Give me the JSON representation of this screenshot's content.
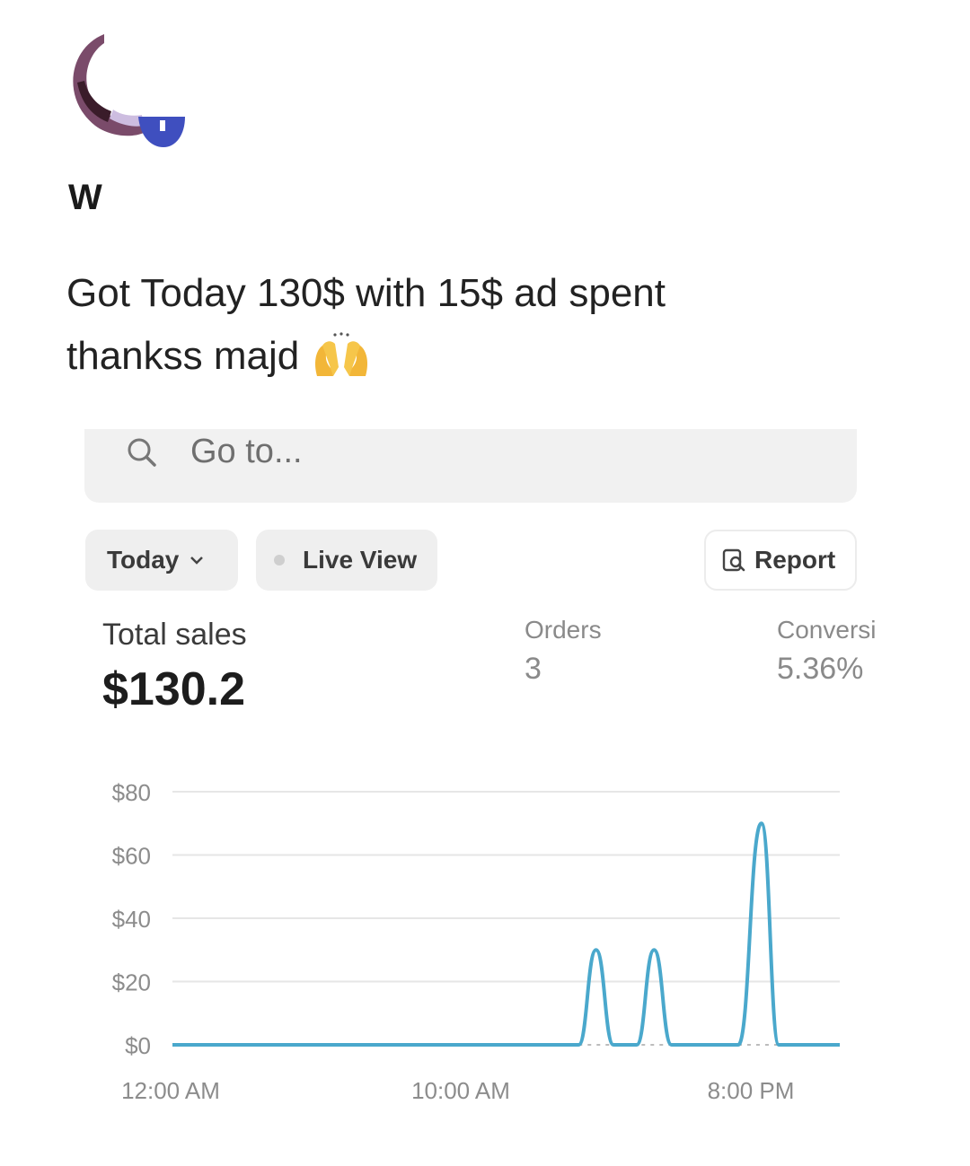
{
  "post": {
    "author": "W",
    "text_line1": "Got Today 130$ with 15$ ad spent",
    "text_line2": "thankss majd",
    "emoji": "raising-hands-emoji"
  },
  "search": {
    "placeholder": "Go to..."
  },
  "toolbar": {
    "period_label": "Today",
    "live_view_label": "Live View",
    "report_label": "Report"
  },
  "metrics": {
    "total_sales_label": "Total sales",
    "total_sales_value": "$130.2",
    "orders_label": "Orders",
    "orders_value": "3",
    "conversion_label": "Conversi",
    "conversion_value": "5.36%"
  },
  "colors": {
    "line": "#4aa8cc",
    "accent_avatar": "#3f4fbf"
  },
  "chart_data": {
    "type": "line",
    "title": "",
    "xlabel": "",
    "ylabel": "",
    "ylim": [
      0,
      80
    ],
    "yticks": [
      "$0",
      "$20",
      "$40",
      "$60",
      "$80"
    ],
    "xticks": [
      "12:00 AM",
      "10:00 AM",
      "8:00 PM"
    ],
    "x_range_hours": [
      0,
      23
    ],
    "grid": true,
    "series": [
      {
        "x": [
          0,
          14,
          14.6,
          15.2,
          16,
          16.6,
          17.2,
          18,
          19.5,
          20.3,
          20.9,
          23
        ],
        "values": [
          0,
          0,
          30,
          0,
          0,
          30,
          0,
          0,
          0,
          70,
          0,
          0
        ]
      }
    ]
  }
}
